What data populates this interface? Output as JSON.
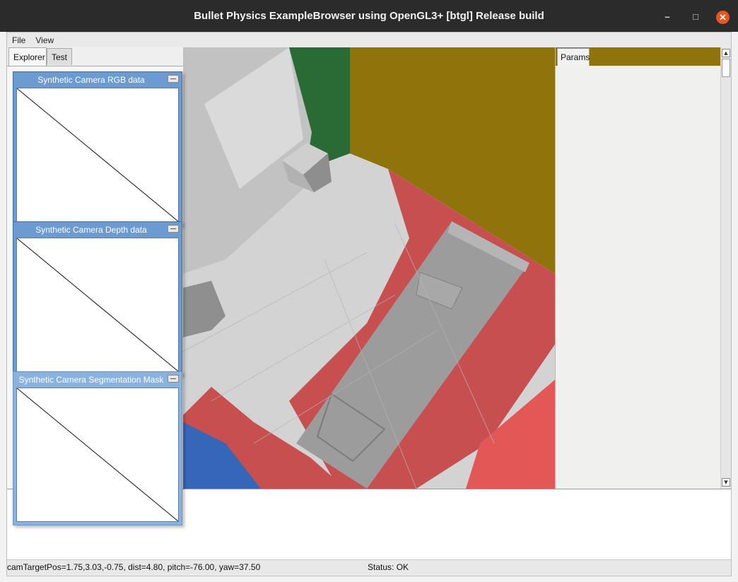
{
  "window": {
    "title": "Bullet Physics ExampleBrowser using OpenGL3+ [btgl] Release build",
    "controls": [
      "minimize-icon",
      "maximize-icon",
      "close-icon"
    ],
    "close_color": "#e95420"
  },
  "menu": {
    "file": "File",
    "view": "View"
  },
  "left_tabs": {
    "explorer": "Explorer",
    "test": "Test"
  },
  "params": {
    "tab": "Params",
    "strip_color": "#8f730b"
  },
  "camera_windows": [
    {
      "title": "Synthetic Camera RGB data"
    },
    {
      "title": "Synthetic Camera Depth data"
    },
    {
      "title": "Synthetic Camera Segmentation Mask"
    }
  ],
  "status": {
    "camera": "camTargetPos=1.75,3.03,-0.75, dist=4.80, pitch=-76.00, yaw=37.50",
    "state": "Status: OK"
  },
  "colors": {
    "wall_green": "#2a6a35",
    "wall_olive": "#8f730b",
    "floor_red": "#c84f4f",
    "floor_blue": "#3666b8",
    "object_gray": "#9a9a9a"
  }
}
